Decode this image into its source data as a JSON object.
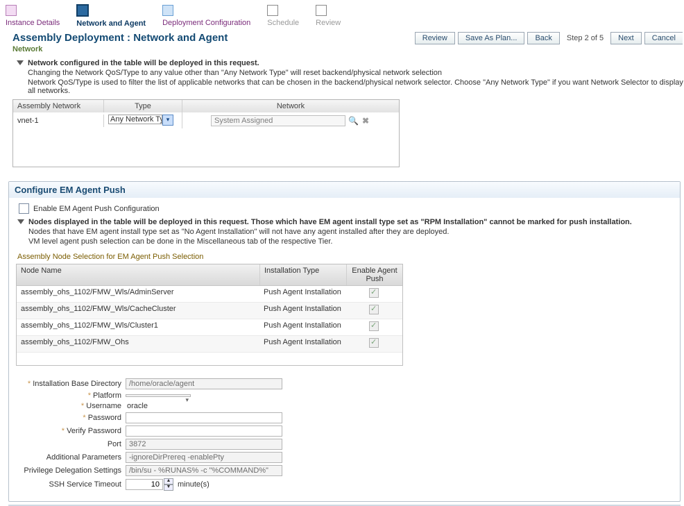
{
  "wizard": {
    "steps": [
      {
        "label": "Instance Details",
        "state": "done"
      },
      {
        "label": "Network and Agent",
        "state": "current"
      },
      {
        "label": "Deployment Configuration",
        "state": "next"
      },
      {
        "label": "Schedule",
        "state": "future"
      },
      {
        "label": "Review",
        "state": "future"
      }
    ]
  },
  "header": {
    "title": "Assembly Deployment : Network and Agent",
    "buttons": {
      "review": "Review",
      "save": "Save As Plan...",
      "back": "Back",
      "step": "Step 2 of 5",
      "next": "Next",
      "cancel": "Cancel"
    }
  },
  "network": {
    "section": "Network",
    "disclosure_title": "Network configured in the table will be deployed in this request.",
    "disclosure_line1": "Changing the Network QoS/Type to any value other than \"Any Network Type\" will reset backend/physical network selection",
    "disclosure_line2": "Network QoS/Type is used to filter the list of applicable networks that can be chosen in the backend/physical network selector. Choose \"Any Network Type\" if you want Network Selector to display all networks.",
    "columns": {
      "c1": "Assembly Network",
      "c2": "Type",
      "c3": "Network"
    },
    "rows": [
      {
        "name": "vnet-1",
        "type": "Any Network Type",
        "network": "System Assigned"
      }
    ]
  },
  "agent": {
    "panel_title": "Configure EM Agent Push",
    "enable_label": "Enable EM Agent Push Configuration",
    "disclosure_title": "Nodes displayed in the table will be deployed in this request. Those which have EM agent install type set as \"RPM Installation\" cannot be marked for push installation.",
    "disclosure_line1": "Nodes that have EM agent install type set as \"No Agent Installation\" will not have any agent installed after they are deployed.",
    "disclosure_line2": "VM level agent push selection can be done in the Miscellaneous tab of the respective Tier.",
    "node_selection_label": "Assembly Node Selection for EM Agent Push Selection",
    "columns": {
      "c1": "Node Name",
      "c2": "Installation Type",
      "c3": "Enable Agent Push"
    },
    "rows": [
      {
        "name": "assembly_ohs_1102/FMW_Wls/AdminServer",
        "type": "Push Agent Installation",
        "checked": true
      },
      {
        "name": "assembly_ohs_1102/FMW_Wls/CacheCluster",
        "type": "Push Agent Installation",
        "checked": true
      },
      {
        "name": "assembly_ohs_1102/FMW_Wls/Cluster1",
        "type": "Push Agent Installation",
        "checked": true
      },
      {
        "name": "assembly_ohs_1102/FMW_Ohs",
        "type": "Push Agent Installation",
        "checked": true
      }
    ]
  },
  "form": {
    "install_dir": {
      "label": "Installation Base Directory",
      "value": "/home/oracle/agent"
    },
    "platform": {
      "label": "Platform",
      "value": ""
    },
    "username": {
      "label": "Username",
      "value": "oracle"
    },
    "password": {
      "label": "Password",
      "value": ""
    },
    "verify_password": {
      "label": "Verify Password",
      "value": ""
    },
    "port": {
      "label": "Port",
      "value": "3872"
    },
    "addl_params": {
      "label": "Additional Parameters",
      "value": "-ignoreDirPrereq -enablePty"
    },
    "priv_deleg": {
      "label": "Privilege Delegation Settings",
      "value": "/bin/su - %RUNAS% -c \"%COMMAND%\""
    },
    "ssh_timeout": {
      "label": "SSH Service Timeout",
      "value": "10",
      "unit": "minute(s)"
    }
  }
}
